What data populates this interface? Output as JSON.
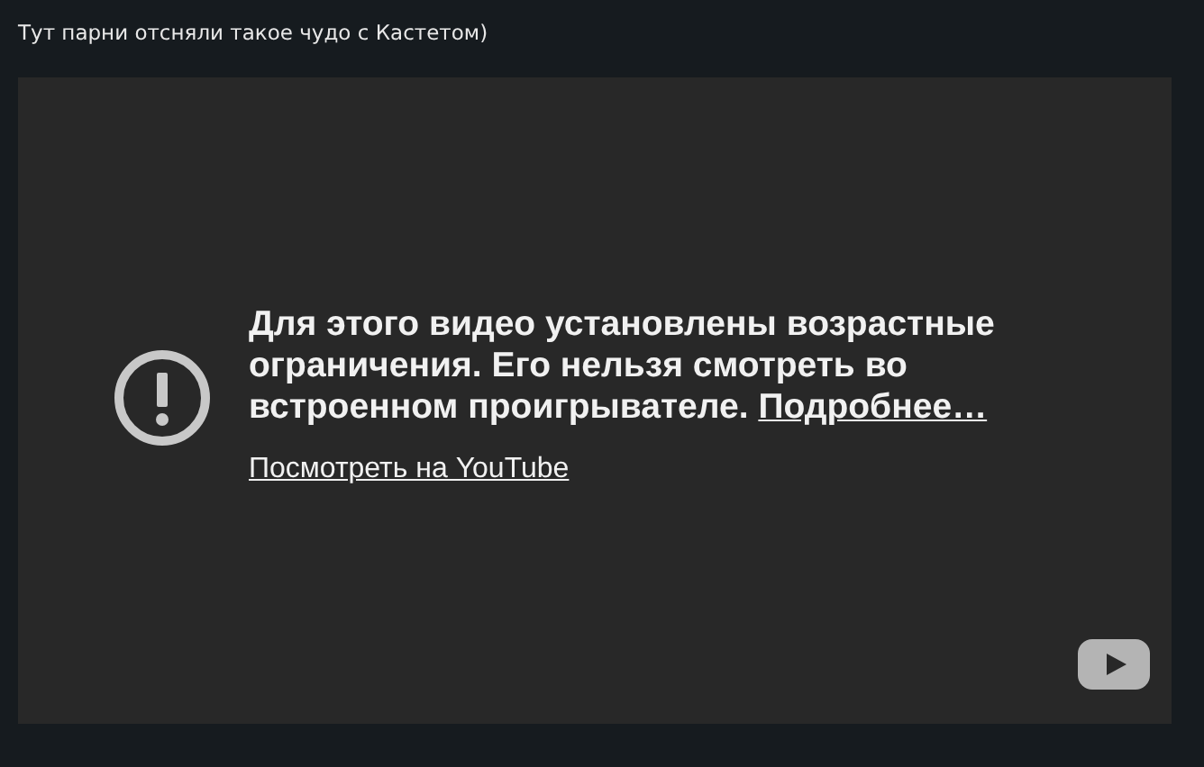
{
  "post": {
    "text": "Тут парни отсняли такое чудо с Кастетом)"
  },
  "video": {
    "message": "Для этого видео установлены возрастные ограничения. Его нельзя смотреть во встроенном проигрывателе.",
    "more_link": "Подробнее…",
    "watch_link": "Посмотреть на YouTube"
  }
}
